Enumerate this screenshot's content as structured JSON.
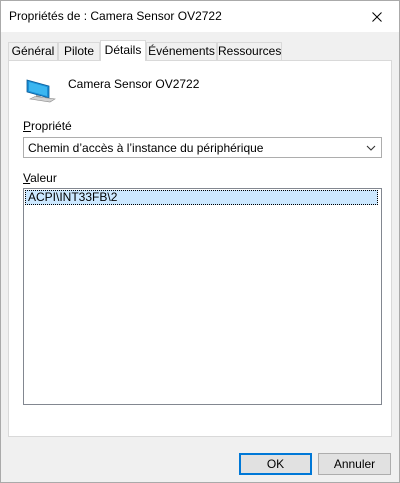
{
  "window": {
    "title": "Propriétés de : Camera Sensor OV2722"
  },
  "tabs": [
    {
      "label": "Général"
    },
    {
      "label": "Pilote"
    },
    {
      "label": "Détails"
    },
    {
      "label": "Événements"
    },
    {
      "label": "Ressources"
    }
  ],
  "active_tab": "Détails",
  "device": {
    "name": "Camera Sensor OV2722",
    "icon": "monitor-icon"
  },
  "property": {
    "label_first": "P",
    "label_rest": "ropriété",
    "selected": "Chemin d’accès à l’instance du périphérique"
  },
  "value": {
    "label_first": "V",
    "label_rest": "aleur",
    "items": [
      "ACPI\\INT33FB\\2"
    ]
  },
  "buttons": {
    "ok": "OK",
    "cancel": "Annuler"
  },
  "colors": {
    "selection": "#cce8ff",
    "accent": "#0078d7"
  }
}
